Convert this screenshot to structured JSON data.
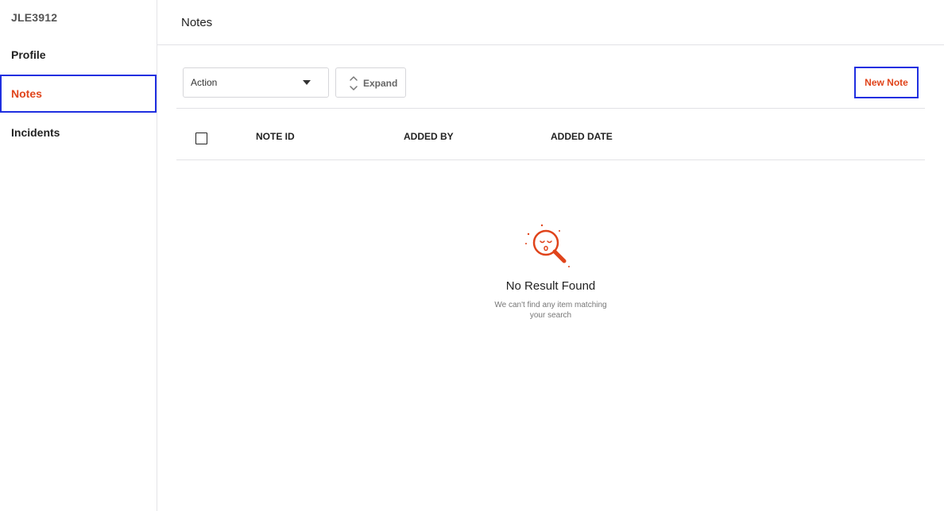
{
  "sidebar": {
    "identifier": "JLE3912",
    "items": [
      {
        "label": "Profile"
      },
      {
        "label": "Notes"
      },
      {
        "label": "Incidents"
      }
    ]
  },
  "header": {
    "title": "Notes"
  },
  "toolbar": {
    "action_select": {
      "selected": "Action"
    },
    "expand_label": "Expand",
    "new_note_label": "New Note"
  },
  "table": {
    "columns": [
      "NOTE ID",
      "ADDED BY",
      "ADDED DATE"
    ],
    "rows": []
  },
  "empty_state": {
    "title": "No Result Found",
    "line1": "We can't find any item matching",
    "line2": "your search",
    "icon": "magnifier-sad-face-icon"
  },
  "colors": {
    "accent": "#e0441b",
    "highlight_border": "#1f2fe0"
  }
}
